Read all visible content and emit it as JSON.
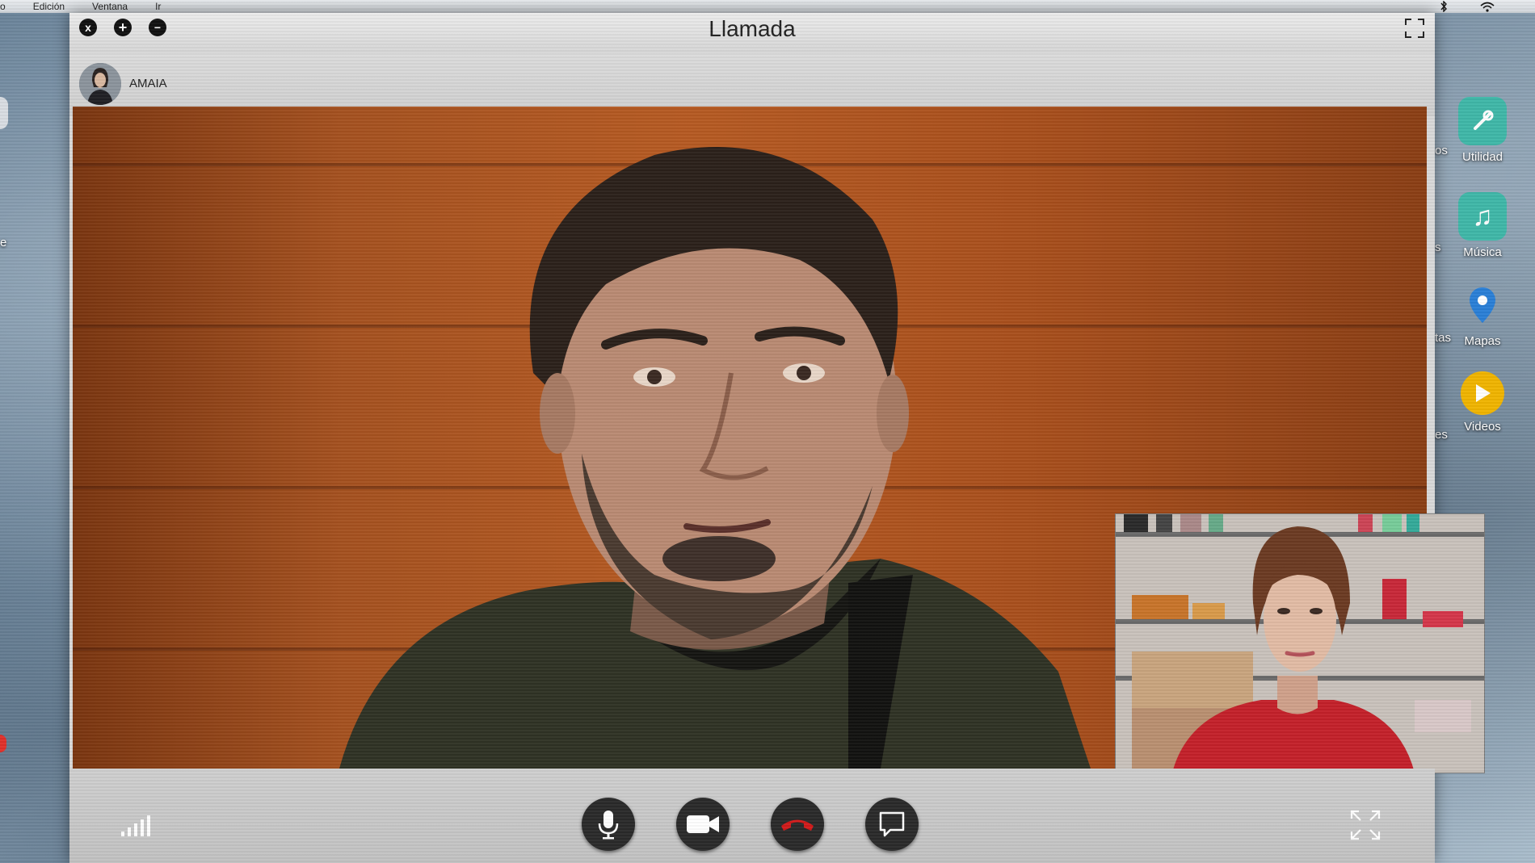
{
  "menubar": {
    "items": [
      "o",
      "Edición",
      "Ventana",
      "Ir"
    ]
  },
  "desktop": {
    "left_labels": [
      "e"
    ],
    "right_partial_labels": [
      "os",
      "s",
      "tas",
      "es"
    ],
    "icons": [
      {
        "label": "Utilidad",
        "icon": "utility-icon",
        "color": "#3fb7a8"
      },
      {
        "label": "Música",
        "icon": "music-icon",
        "color": "#3fb7a8"
      },
      {
        "label": "Mapas",
        "icon": "map-pin-icon",
        "color": "#2a7fd6"
      },
      {
        "label": "Videos",
        "icon": "play-icon",
        "color": "#f0b400"
      }
    ]
  },
  "window": {
    "title": "Llamada",
    "close_label": "x",
    "add_label": "+",
    "minimize_label": "−",
    "contact_name": "AMAIA"
  },
  "controls": {
    "hangup_color": "#d11a1a"
  }
}
